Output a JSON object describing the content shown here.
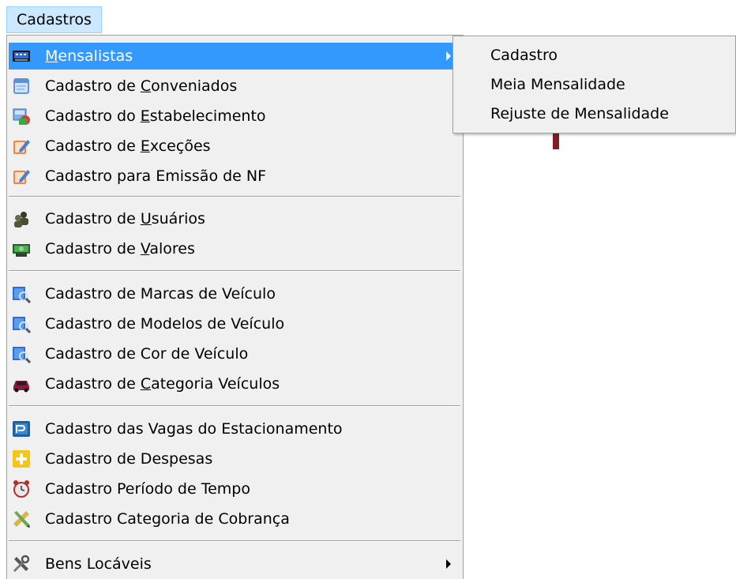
{
  "menubar": {
    "title": "Cadastros"
  },
  "menu": {
    "items": [
      {
        "pre": "",
        "u": "M",
        "post": "ensalistas",
        "icon": "keyboard-icon"
      },
      {
        "pre": "Cadastro de ",
        "u": "C",
        "post": "onveniados",
        "icon": "document-icon"
      },
      {
        "pre": "Cadastro do ",
        "u": "E",
        "post": "stabelecimento",
        "icon": "store-icon"
      },
      {
        "pre": "Cadastro de ",
        "u": "E",
        "post": "xceções",
        "icon": "edit-icon"
      },
      {
        "pre": "Cadastro para Emissão de NF",
        "u": "",
        "post": "",
        "icon": "edit-icon"
      },
      {
        "pre": "Cadastro de ",
        "u": "U",
        "post": "suários",
        "icon": "users-icon"
      },
      {
        "pre": "Cadastro de ",
        "u": "V",
        "post": "alores",
        "icon": "money-icon"
      },
      {
        "pre": "Cadastro de Marcas de Veículo",
        "u": "",
        "post": "",
        "icon": "search-icon"
      },
      {
        "pre": "Cadastro de Modelos de Veículo",
        "u": "",
        "post": "",
        "icon": "search-icon"
      },
      {
        "pre": "Cadastro de Cor de Veículo",
        "u": "",
        "post": "",
        "icon": "search-icon"
      },
      {
        "pre": "Cadastro de ",
        "u": "C",
        "post": "ategoria Veículos",
        "icon": "car-icon"
      },
      {
        "pre": "Cadastro das Vagas do Estacionamento",
        "u": "",
        "post": "",
        "icon": "parking-icon"
      },
      {
        "pre": "Cadastro de Despesas",
        "u": "",
        "post": "",
        "icon": "expense-icon"
      },
      {
        "pre": "Cadastro Período de Tempo",
        "u": "",
        "post": "",
        "icon": "alarm-clock-icon"
      },
      {
        "pre": "Cadastro Categoria de Cobrança",
        "u": "",
        "post": "",
        "icon": "ruler-pencil-icon"
      },
      {
        "pre": "Bens Locáveis",
        "u": "",
        "post": "",
        "icon": "tools-icon"
      }
    ]
  },
  "submenu": {
    "items": [
      "Cadastro",
      "Meia Mensalidade",
      "Rejuste de Mensalidade"
    ]
  },
  "colors": {
    "highlight": "#3399ff",
    "menu_bg": "#f0f0f0",
    "menubar_active": "#cce8ff"
  }
}
